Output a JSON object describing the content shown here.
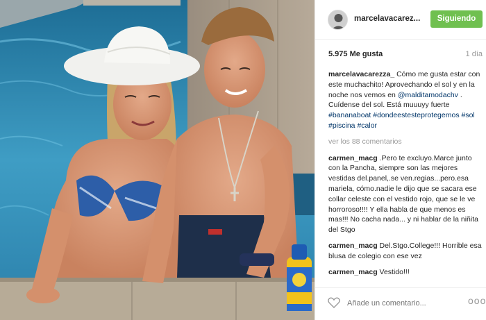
{
  "post": {
    "username": "marcelavacarez...",
    "follow_label": "Siguiendo",
    "likes": "5.975 Me gusta",
    "time": "1 día",
    "view_all": "ver los 88 comentarios",
    "caption": {
      "author": "marcelavacarezza_",
      "text_1": " Cómo me gusta estar con este muchachito! Aprovechando el sol y en la noche nos vemos en ",
      "mention": "@malditamodachv",
      "text_2": " . Cuídense del sol. Está muuuyy fuerte ",
      "hashtags": "#bananaboat #dondeestesteprotegemos #sol #piscina #calor"
    },
    "comments": [
      {
        "author": "carmen_macg",
        "text": " .Pero te excluyo.Marce junto con la Pancha, siempre son las mejores vestidas del.panel,.se ven.regias...pero.esa mariela, cómo.nadie le dijo que se sacara ese collar celeste con el vestido rojo, que se le ve horroroso!!!! Y ella habla de que menos es mas!!! No cacha nada... y ni hablar de la niñita del Stgo"
      },
      {
        "author": "carmen_macg",
        "text": " Del.Stgo.College!!! Horrible esa blusa de colegio con ese vez"
      },
      {
        "author": "carmen_macg",
        "text": " Vestido!!!"
      }
    ],
    "add_comment_placeholder": "Añade un comentario...",
    "more_label": "ooo"
  },
  "photo": {
    "sunscreen_label": "BANANA BOAT"
  },
  "colors": {
    "follow_button": "#70c050",
    "link": "#003569",
    "muted": "#999999"
  },
  "icons": {
    "like": "heart-outline-icon",
    "more": "ellipsis-icon"
  }
}
